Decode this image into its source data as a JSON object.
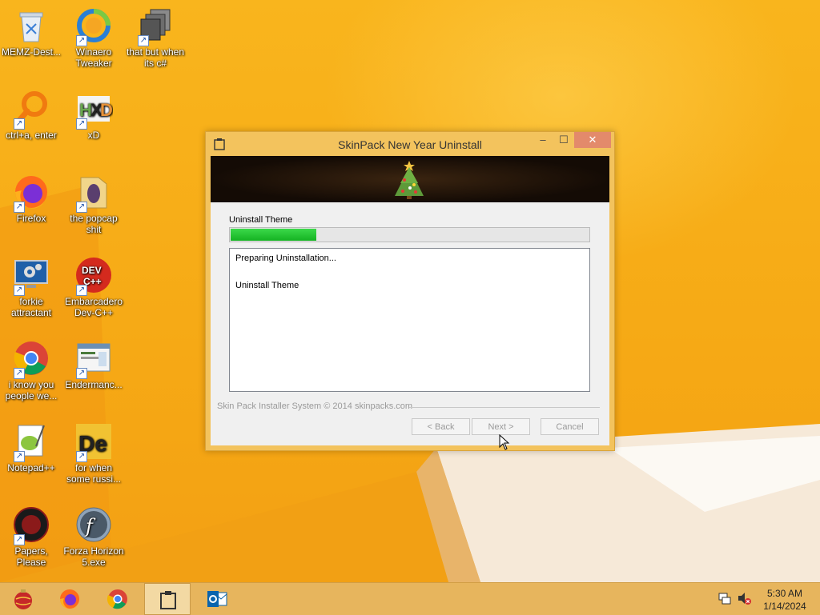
{
  "desktop": {
    "icons": [
      {
        "label": "MEMZ-Dest...",
        "icon": "recycle-bin-icon"
      },
      {
        "label": "Winaero Tweaker",
        "icon": "winaero-icon"
      },
      {
        "label": "that but when its c#",
        "icon": "stack-icon"
      },
      {
        "label": "ctrl+a, enter",
        "icon": "magnifier-icon"
      },
      {
        "label": "xD",
        "icon": "hxd-icon"
      },
      {
        "label": "Firefox",
        "icon": "firefox-icon"
      },
      {
        "label": "the popcap shit",
        "icon": "folder-icon"
      },
      {
        "label": "forkie attractant",
        "icon": "monitor-gear-icon"
      },
      {
        "label": "Embarcadero Dev-C++",
        "icon": "devcpp-icon"
      },
      {
        "label": "i know you people we...",
        "icon": "chrome-icon"
      },
      {
        "label": "Endermanc...",
        "icon": "window-app-icon"
      },
      {
        "label": "Notepad++",
        "icon": "notepadpp-icon"
      },
      {
        "label": "for when some russi...",
        "icon": "de-icon"
      },
      {
        "label": "Papers, Please",
        "icon": "papers-please-icon"
      },
      {
        "label": "Forza Horizon 5.exe",
        "icon": "flash-icon"
      }
    ]
  },
  "window": {
    "title": "SkinPack New Year Uninstall",
    "controls": {
      "minimize": "–",
      "maximize": "☐",
      "close": "✕"
    },
    "section_label": "Uninstall Theme",
    "progress": 0.24,
    "log_lines": [
      "Preparing Uninstallation...",
      "Uninstall Theme"
    ],
    "footer": "Skin Pack Installer System © 2014 skinpacks.com",
    "buttons": {
      "back": "< Back",
      "next": "Next >",
      "cancel": "Cancel"
    }
  },
  "taskbar": {
    "items": [
      "start-ornament-icon",
      "firefox-icon",
      "chrome-icon",
      "installer-icon",
      "outlook-icon"
    ],
    "clock": {
      "time": "5:30 AM",
      "date": "1/14/2024"
    }
  },
  "colors": {
    "accent": "#f7b21c",
    "progress": "#14b222",
    "close_button": "#e38a6b"
  }
}
